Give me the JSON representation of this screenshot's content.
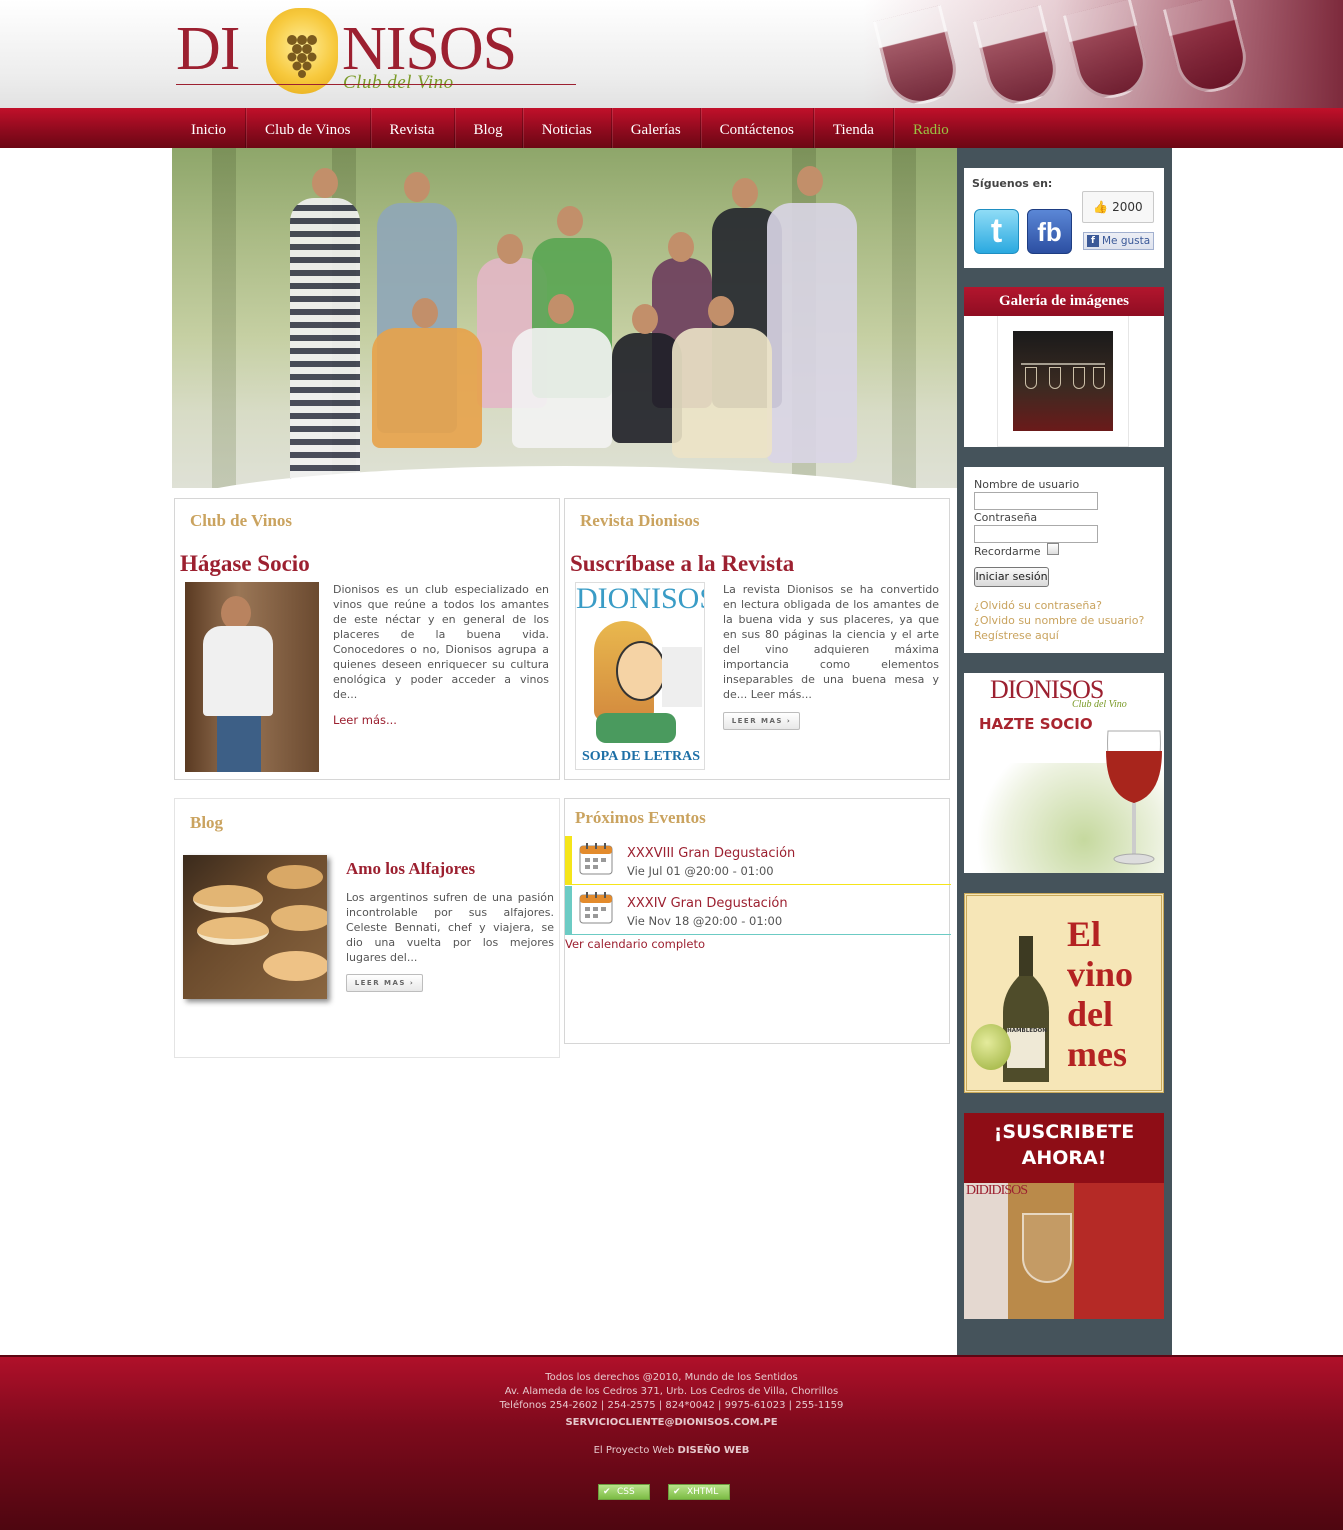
{
  "brand": {
    "name_left": "DI",
    "name_right": "NISOS",
    "tagline": "Club del Vino"
  },
  "nav": {
    "items": [
      {
        "label": "Inicio"
      },
      {
        "label": "Club de Vinos"
      },
      {
        "label": "Revista"
      },
      {
        "label": "Blog"
      },
      {
        "label": "Noticias"
      },
      {
        "label": "Galerías"
      },
      {
        "label": "Contáctenos"
      },
      {
        "label": "Tienda"
      },
      {
        "label": "Radio"
      }
    ],
    "active_color": "#9ac343"
  },
  "club": {
    "section_title": "Club de Vinos",
    "headline": "Hágase Socio",
    "text": "Dionisos es un club especializado en vinos que reúne a todos los amantes de este néctar y en general de los placeres de la buena vida. Conocedores o no, Dionisos agrupa a quienes deseen enriquecer su cultura enológica y poder acceder a vinos de...",
    "read_more": "Leer más..."
  },
  "revista": {
    "section_title": "Revista Dionisos",
    "headline": "Suscríbase a la Revista",
    "text": "La revista Dionisos se ha convertido en lectura obligada de los amantes de la buena vida y sus placeres, ya que en sus 80 páginas la ciencia y el arte del vino adquieren máxima importancia como elementos inseparables de una buena mesa y de... Leer más...",
    "button": "LEER MAS",
    "cover_title": "DIONISOS",
    "cover_bottom": "SOPA DE LETRAS"
  },
  "blog": {
    "section_title": "Blog",
    "post_title": "Amo los Alfajores",
    "text": "Los argentinos sufren de una pasión incontrolable por sus alfajores. Celeste Bennati, chef y viajera, se dio una vuelta por los mejores lugares del...",
    "button": "LEER MAS"
  },
  "events": {
    "section_title": "Próximos Eventos",
    "items": [
      {
        "title": "XXXVIII Gran Degustación",
        "date": "Vie Jul 01 @20:00 - 01:00",
        "color": "#f5e51a"
      },
      {
        "title": "XXXIV Gran Degustación",
        "date": "Vie Nov 18 @20:00 - 01:00",
        "color": "#6ccbc4"
      }
    ],
    "calendar_link": "Ver calendario completo"
  },
  "sidebar": {
    "social": {
      "label": "Síguenos en:",
      "twitter": "t",
      "facebook": "fb",
      "like_count": "2000",
      "like_label": "Me gusta"
    },
    "gallery": {
      "title": "Galería de imágenes"
    },
    "login": {
      "username_label": "Nombre de usuario",
      "password_label": "Contraseña",
      "remember_label": "Recordarme",
      "submit": "Iniciar sesión",
      "forgot_password": "¿Olvidó su contraseña?",
      "forgot_username": "¿Olvido su nombre de usuario?",
      "register": "Regístrese aquí"
    },
    "banner_socio": {
      "brand": "DIONISOS",
      "tagline": "Club del Vino",
      "text": "HAZTE SOCIO"
    },
    "banner_vino": {
      "line1": "El",
      "line2": "vino",
      "line3": "del",
      "line4": "mes",
      "bottle_label": "HAMBLEDON"
    },
    "banner_suscribe": {
      "line1": "¡SUSCRIBETE",
      "line2": "AHORA!"
    }
  },
  "footer": {
    "copyright": "Todos los derechos @2010, Mundo de los Sentidos",
    "address": "Av. Alameda de los Cedros 371, Urb. Los Cedros de Villa, Chorrillos",
    "phones": "Teléfonos 254-2602 | 254-2575 | 824*0042 | 9975-61023 | 255-1159",
    "email": "SERVICIOCLIENTE@DIONISOS.COM.PE",
    "project_prefix": "El Proyecto Web",
    "project_link": "DISEÑO WEB",
    "badge_css": "CSS",
    "badge_xhtml": "XHTML"
  }
}
